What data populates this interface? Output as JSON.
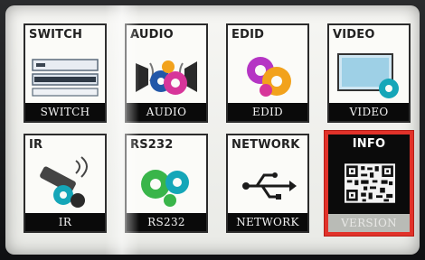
{
  "tiles": [
    {
      "title": "SWITCH",
      "caption": "SWITCH",
      "icon": "switch-icon"
    },
    {
      "title": "AUDIO",
      "caption": "AUDIO",
      "icon": "audio-gears-icon"
    },
    {
      "title": "EDID",
      "caption": "EDID",
      "icon": "edid-gears-icon"
    },
    {
      "title": "VIDEO",
      "caption": "VIDEO",
      "icon": "monitor-gear-icon"
    },
    {
      "title": "IR",
      "caption": "IR",
      "icon": "ir-remote-gear-icon"
    },
    {
      "title": "RS232",
      "caption": "RS232",
      "icon": "rs232-gears-icon"
    },
    {
      "title": "NETWORK",
      "caption": "NETWORK",
      "icon": "usb-network-icon"
    },
    {
      "title": "INFO",
      "caption": "VERSION",
      "icon": "qr-code-icon",
      "selected": true
    }
  ],
  "colors": {
    "selection": "#e1322a",
    "caption_bg": "#0a0a0a",
    "gear_magenta": "#d7359a",
    "gear_orange": "#f2a21c",
    "gear_teal": "#15a6b8",
    "gear_green": "#39b54a",
    "gear_blue": "#2257a8"
  }
}
